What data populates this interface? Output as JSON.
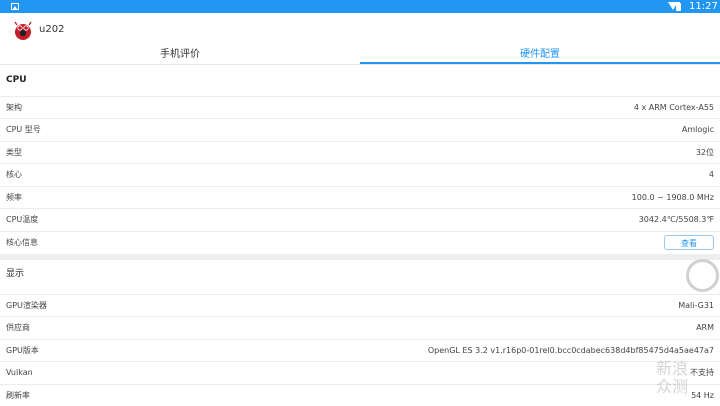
{
  "status_bar": {
    "time": "11:27"
  },
  "app_bar": {
    "device_name": "u202"
  },
  "tabs": [
    {
      "label": "手机评价"
    },
    {
      "label": "硬件配置"
    }
  ],
  "cpu": {
    "title": "CPU",
    "rows": [
      {
        "label": "架构",
        "value": "4 x ARM Cortex-A55"
      },
      {
        "label": "CPU 型号",
        "value": "Amlogic"
      },
      {
        "label": "类型",
        "value": "32位"
      },
      {
        "label": "核心",
        "value": "4"
      },
      {
        "label": "频率",
        "value": "100.0 ~ 1908.0 MHz"
      },
      {
        "label": "CPU温度",
        "value": "3042.4℃/5508.3℉"
      },
      {
        "label": "核心信息",
        "button": "查看"
      }
    ]
  },
  "display": {
    "title": "显示",
    "rows": [
      {
        "label": "GPU渲染器",
        "value": "Mali-G31"
      },
      {
        "label": "供应商",
        "value": "ARM"
      },
      {
        "label": "GPU版本",
        "value": "OpenGL ES 3.2 v1.r16p0-01rel0.bcc0cdabec638d4bf85475d4a5ae47a7"
      },
      {
        "label": "Vulkan",
        "value": "不支持"
      },
      {
        "label": "刷新率",
        "value": "54 Hz"
      }
    ]
  },
  "watermark": "新浪众测"
}
